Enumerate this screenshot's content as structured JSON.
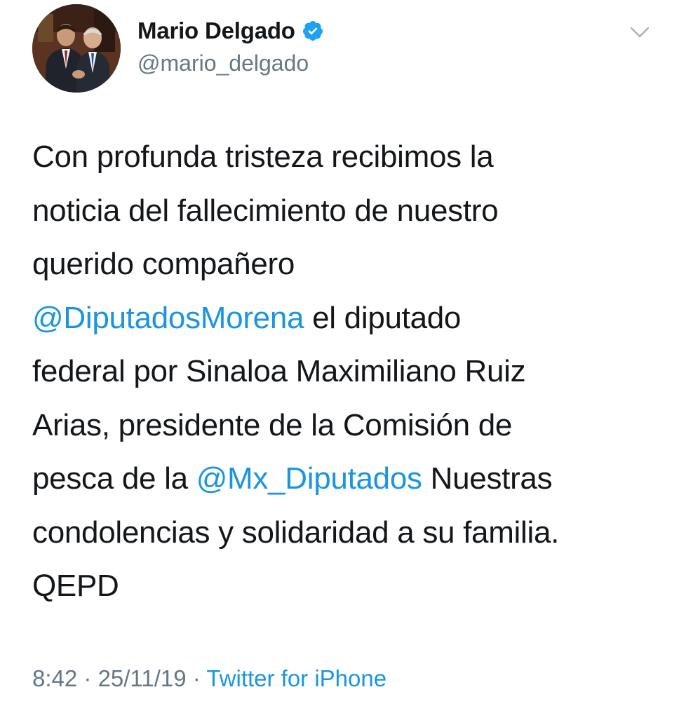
{
  "author": {
    "display_name": "Mario Delgado",
    "handle": "@mario_delgado",
    "verified_icon": "verified-badge-icon",
    "avatar_icon": "profile-photo"
  },
  "menu": {
    "icon": "chevron-down-icon"
  },
  "tweet": {
    "lines": [
      {
        "parts": [
          {
            "text": "Con profunda tristeza recibimos la",
            "mention": false
          }
        ]
      },
      {
        "parts": [
          {
            "text": "noticia del fallecimiento de nuestro",
            "mention": false
          }
        ]
      },
      {
        "parts": [
          {
            "text": "querido compañero",
            "mention": false
          }
        ]
      },
      {
        "parts": [
          {
            "text": "@DiputadosMorena",
            "mention": true
          },
          {
            "text": " el diputado",
            "mention": false
          }
        ]
      },
      {
        "parts": [
          {
            "text": "federal por Sinaloa Maximiliano Ruiz",
            "mention": false
          }
        ]
      },
      {
        "parts": [
          {
            "text": "Arias, presidente de la Comisión de",
            "mention": false
          }
        ]
      },
      {
        "parts": [
          {
            "text": "pesca de la ",
            "mention": false
          },
          {
            "text": "@Mx_Diputados",
            "mention": true
          },
          {
            "text": " Nuestras",
            "mention": false
          }
        ]
      },
      {
        "parts": [
          {
            "text": "condolencias y solidaridad a su familia.",
            "mention": false
          }
        ]
      },
      {
        "parts": [
          {
            "text": "QEPD",
            "mention": false
          }
        ]
      }
    ]
  },
  "meta": {
    "time": "8:42",
    "separator": " · ",
    "date": "25/11/19",
    "source": "Twitter for iPhone"
  },
  "colors": {
    "text": "#14171a",
    "secondary": "#657786",
    "link": "#1b95e0",
    "verified": "#1da1f2"
  }
}
